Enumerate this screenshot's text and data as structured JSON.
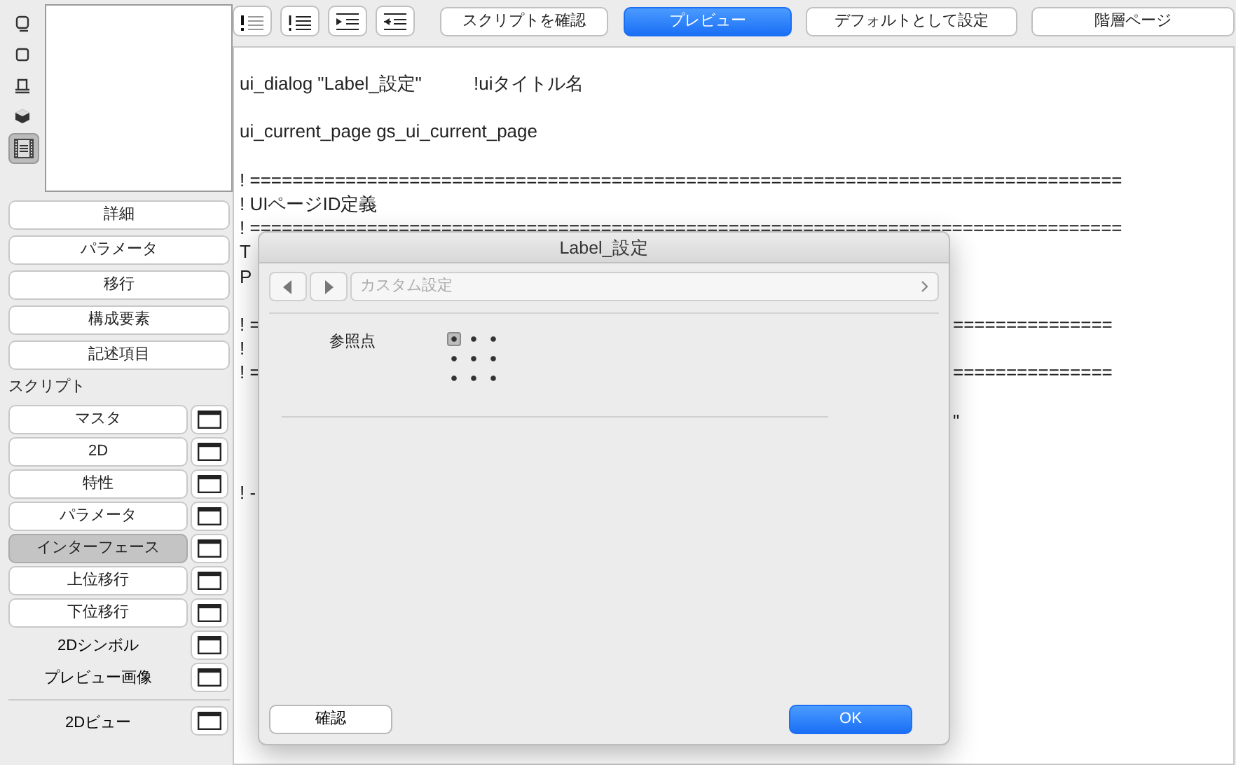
{
  "view_buttons": [
    {
      "kind": "window",
      "selected": false
    },
    {
      "kind": "square",
      "selected": false
    },
    {
      "kind": "table",
      "selected": false
    },
    {
      "kind": "cube",
      "selected": false
    },
    {
      "kind": "film",
      "selected": true
    }
  ],
  "section_buttons": [
    "詳細",
    "パラメータ",
    "移行",
    "構成要素",
    "記述項目"
  ],
  "script_heading": "スクリプト",
  "scripts": [
    {
      "label": "マスタ",
      "kind": "button",
      "selected": false
    },
    {
      "label": "2D",
      "kind": "button",
      "selected": false
    },
    {
      "label": "特性",
      "kind": "button",
      "selected": false
    },
    {
      "label": "パラメータ",
      "kind": "button",
      "selected": false
    },
    {
      "label": "インターフェース",
      "kind": "button",
      "selected": true
    },
    {
      "label": "上位移行",
      "kind": "button",
      "selected": false
    },
    {
      "label": "下位移行",
      "kind": "button",
      "selected": false
    },
    {
      "label": "2Dシンボル",
      "kind": "plain",
      "selected": false
    },
    {
      "label": "プレビュー画像",
      "kind": "plain",
      "selected": false
    },
    {
      "label": "2Dビュー",
      "kind": "separated",
      "selected": false
    }
  ],
  "toolbar": {
    "format_buttons": [
      {
        "kind": "comment"
      },
      {
        "kind": "uncomment"
      },
      {
        "kind": "indent"
      },
      {
        "kind": "outdent"
      }
    ],
    "buttons": [
      {
        "label": "スクリプトを確認",
        "primary": false
      },
      {
        "label": "プレビュー",
        "primary": true
      },
      {
        "label": "デフォルトとして設定",
        "primary": false
      },
      {
        "label": "階層ページ",
        "primary": false
      }
    ]
  },
  "code_lines": [
    {
      "kind": "code",
      "text": "ui_dialog \"Label_設定\"",
      "comment": "!uiタイトル名"
    },
    {
      "kind": "blank"
    },
    {
      "kind": "code",
      "text": "ui_current_page gs_ui_current_page"
    },
    {
      "kind": "blank"
    },
    {
      "kind": "code",
      "text": "! =================================================================================="
    },
    {
      "kind": "code",
      "text": "! UIページID定義"
    },
    {
      "kind": "code",
      "text": "! =================================================================================="
    },
    {
      "kind": "code",
      "text": "T"
    },
    {
      "kind": "code",
      "text": "P"
    },
    {
      "kind": "blank"
    },
    {
      "kind": "code",
      "text": "! =",
      "tail": "==============="
    },
    {
      "kind": "code",
      "text": "!"
    },
    {
      "kind": "code",
      "text": "! =",
      "tail": "==============="
    },
    {
      "kind": "blank"
    },
    {
      "kind": "code",
      "tail": "\""
    },
    {
      "kind": "blank"
    },
    {
      "kind": "blank"
    },
    {
      "kind": "code",
      "text": "! -"
    }
  ],
  "dialog": {
    "title": "Label_設定",
    "page_path": "カスタム設定",
    "anchor_label": "参照点",
    "anchor_points": [
      {
        "selected": true
      },
      {
        "selected": false
      },
      {
        "selected": false
      },
      {
        "selected": false
      },
      {
        "selected": false
      },
      {
        "selected": false
      },
      {
        "selected": false
      },
      {
        "selected": false
      },
      {
        "selected": false
      }
    ],
    "buttons": [
      {
        "label": "確認",
        "primary": false
      },
      {
        "label": "OK",
        "primary": true
      }
    ]
  }
}
